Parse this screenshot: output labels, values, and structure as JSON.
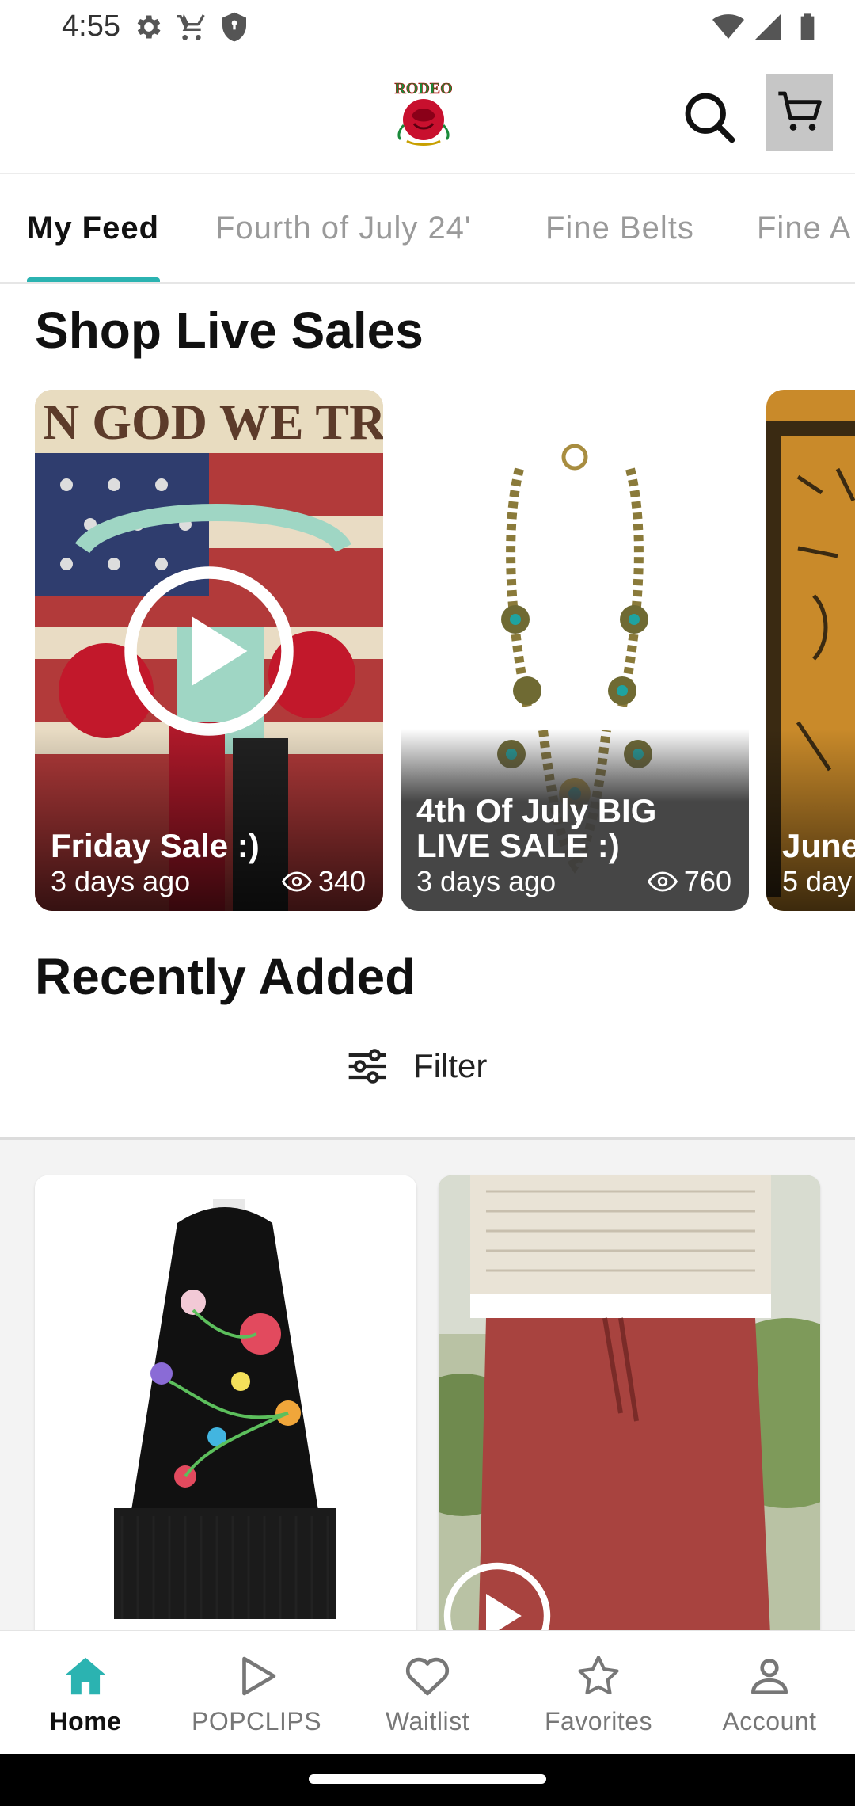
{
  "status_bar": {
    "time": "4:55",
    "left_icons": [
      "gear-icon",
      "cart-icon",
      "shield-icon"
    ],
    "right_icons": [
      "wifi-icon",
      "signal-icon",
      "battery-icon"
    ]
  },
  "header": {
    "logo_text": "RODEO",
    "search_icon": "search-icon",
    "cart_icon": "cart-icon"
  },
  "tabs": [
    {
      "label": "My Feed",
      "active": true
    },
    {
      "label": "Fourth of July 24'",
      "active": false
    },
    {
      "label": "Fine Belts",
      "active": false
    },
    {
      "label": "Fine A",
      "active": false
    }
  ],
  "live_sales": {
    "title": "Shop Live Sales",
    "cards": [
      {
        "title": "Friday Sale :)",
        "time": "3 days ago",
        "views": "340"
      },
      {
        "title": "4th Of July BIG LIVE SALE :)",
        "time": "3 days ago",
        "views": "760"
      },
      {
        "title": "June",
        "time": "5 day",
        "views": ""
      }
    ]
  },
  "recently_added": {
    "title": "Recently Added",
    "filter_label": "Filter"
  },
  "bottom_nav": [
    {
      "label": "Home",
      "icon": "home-icon",
      "active": true
    },
    {
      "label": "POPCLIPS",
      "icon": "play-icon",
      "active": false
    },
    {
      "label": "Waitlist",
      "icon": "heart-icon",
      "active": false
    },
    {
      "label": "Favorites",
      "icon": "star-icon",
      "active": false
    },
    {
      "label": "Account",
      "icon": "person-icon",
      "active": false
    }
  ],
  "colors": {
    "accent": "#2bb3b1",
    "cart_bg": "#c6c6c6"
  }
}
